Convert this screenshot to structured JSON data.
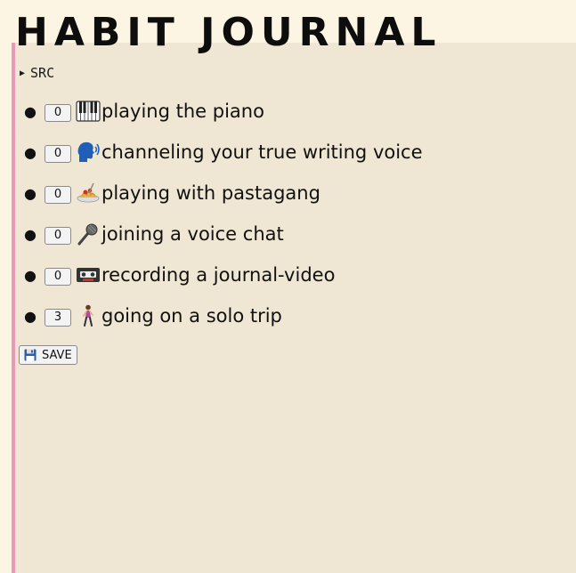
{
  "app": {
    "title": "HABIT JOURNAL"
  },
  "details": {
    "summary_label": "SRC"
  },
  "habits": [
    {
      "count": "0",
      "icon": "piano-keys-icon",
      "label": "playing the piano"
    },
    {
      "count": "0",
      "icon": "speaking-head-icon",
      "label": "channeling your true writing voice"
    },
    {
      "count": "0",
      "icon": "spaghetti-icon",
      "label": "playing with pastagang"
    },
    {
      "count": "0",
      "icon": "microphone-icon",
      "label": "joining a voice chat"
    },
    {
      "count": "0",
      "icon": "videocassette-icon",
      "label": "recording a journal-video"
    },
    {
      "count": "3",
      "icon": "person-walking-icon",
      "label": "going on a solo trip"
    }
  ],
  "toolbar": {
    "save_label": "SAVE",
    "save_icon": "floppy-disk-icon"
  },
  "colors": {
    "page_background": "#fdf5e3",
    "panel_background": "#efe6d3",
    "panel_accent": "#e89ab8"
  }
}
